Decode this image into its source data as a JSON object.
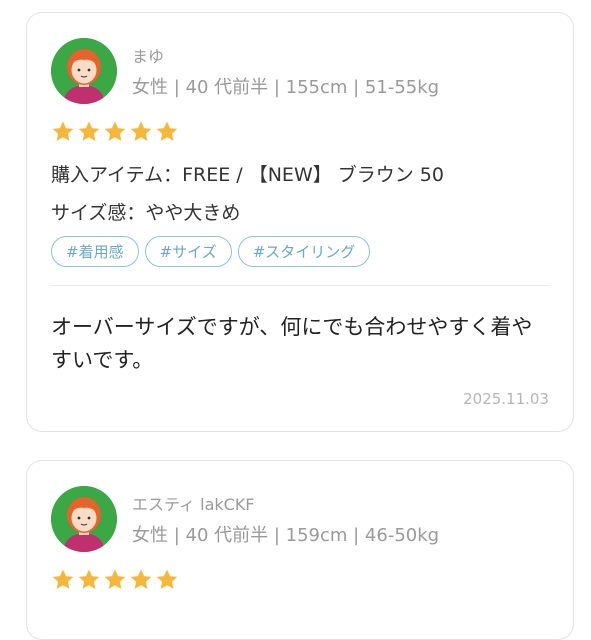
{
  "reviews": [
    {
      "user": {
        "name": "まゆ",
        "meta": "女性 | 40 代前半 | 155cm | 51-55kg"
      },
      "rating": 5,
      "item_line": "購入アイテム：FREE / 【NEW】 ブラウン 50",
      "size_line": "サイズ感：やや大きめ",
      "tags": [
        "#着用感",
        "#サイズ",
        "#スタイリング"
      ],
      "comment": "オーバーサイズですが、何にでも合わせやすく着やすいです。",
      "date": "2025.11.03"
    },
    {
      "user": {
        "name": "エスティ lakCKF",
        "meta": "女性 | 40 代前半 | 159cm | 46-50kg"
      },
      "rating": 5
    }
  ],
  "colors": {
    "star": "#f5b83a",
    "avatar_bg": "#3aa845",
    "hair": "#e8622c",
    "tag_border": "#8ec3da",
    "tag_text": "#6aaac8"
  },
  "icons": {
    "avatar": "avatar-icon",
    "star": "star-icon"
  }
}
